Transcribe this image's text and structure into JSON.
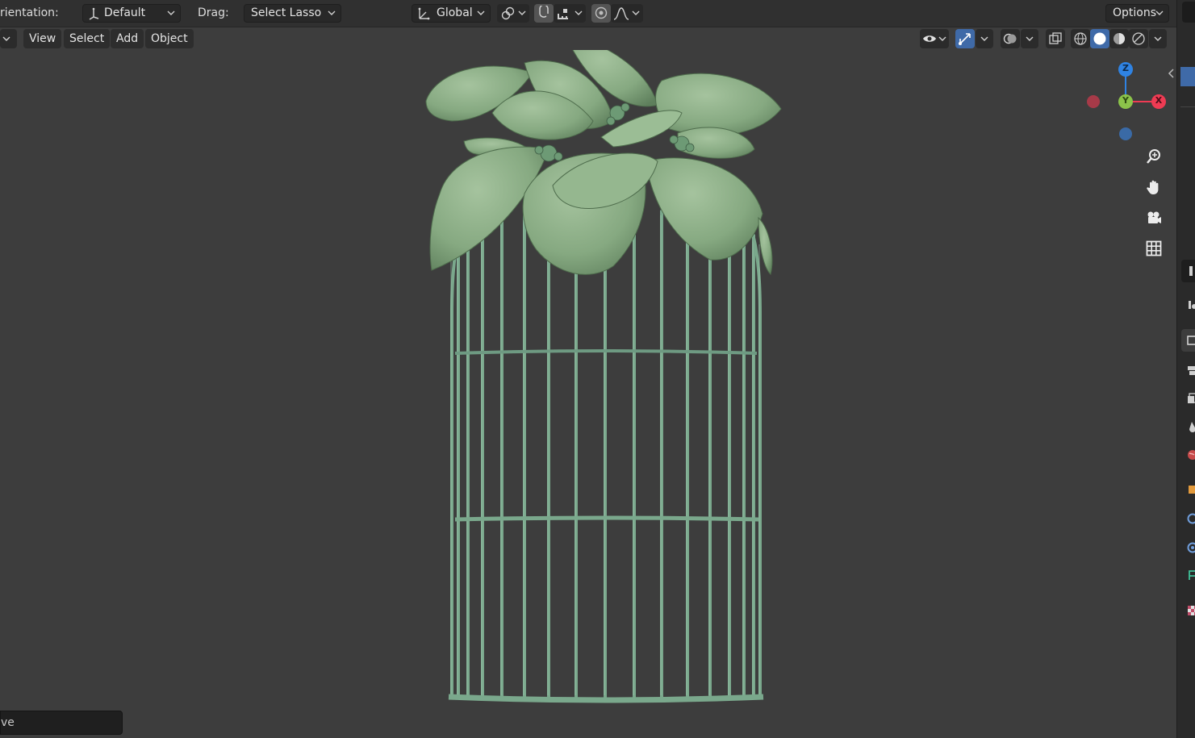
{
  "toolbar": {
    "orientation_label": "rientation:",
    "orientation_value": "Default",
    "drag_label": "Drag:",
    "drag_value": "Select Lasso",
    "transform_orientation": "Global",
    "options_label": "Options"
  },
  "viewport_menu": {
    "items": [
      "View",
      "Select",
      "Add",
      "Object"
    ]
  },
  "gizmo": {
    "z_label": "Z",
    "y_label": "Y",
    "x_label": "X"
  },
  "nav_buttons": [
    "zoom-icon",
    "pan-hand-icon",
    "camera-icon",
    "grid-icon"
  ],
  "status_bar": {
    "field_text": "ve"
  },
  "scene": {
    "object": "birdcage with leaves",
    "model_color": "#7aa88c",
    "background_color": "#3d3d3d"
  },
  "colors": {
    "accent_blue": "#3f6aa8",
    "axis_z": "#2f83e3",
    "axis_y": "#8bc34a",
    "axis_x": "#ee3b53"
  }
}
